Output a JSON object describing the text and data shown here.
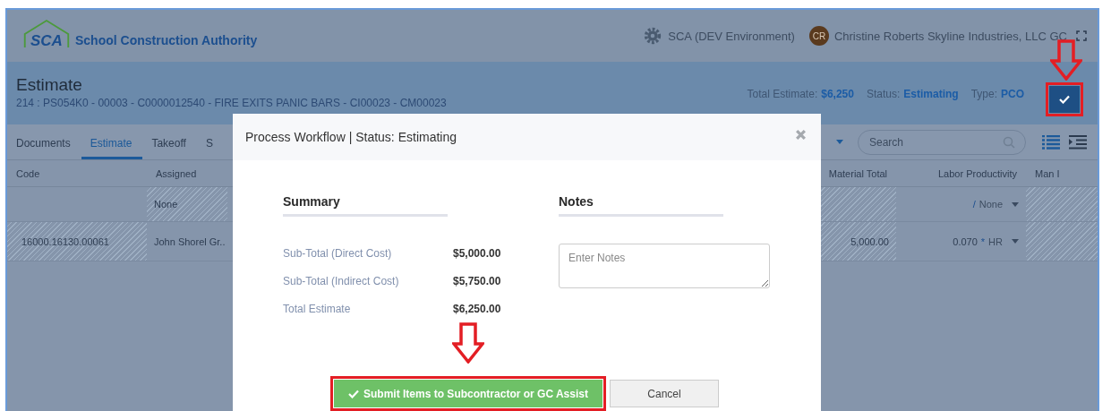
{
  "app": {
    "logo_text": "SCA",
    "name": "School Construction Authority",
    "environment": "SCA (DEV Environment)",
    "user_initials": "CR",
    "user_name": "Christine Roberts Skyline Industries, LLC GC"
  },
  "page": {
    "title": "Estimate",
    "subtitle": "214 : PS054K0 - 00003 - C0000012540 - FIRE EXITS PANIC BARS - CI00023 - CM00023",
    "summary": [
      {
        "label": "Total Estimate:",
        "value": "$6,250"
      },
      {
        "label": "Status:",
        "value": "Estimating"
      },
      {
        "label": "Type:",
        "value": "PCO"
      }
    ],
    "workflow_button": {
      "highlighted": true
    }
  },
  "tabs": [
    {
      "label": "Documents",
      "selected": false
    },
    {
      "label": "Estimate",
      "selected": true
    },
    {
      "label": "Takeoff",
      "selected": false
    },
    {
      "label": "S",
      "selected": false
    }
  ],
  "search": {
    "placeholder": "Search"
  },
  "table": {
    "columns_left": [
      "Code",
      "Assigned"
    ],
    "columns_right": [
      "Material Total",
      "Labor Productivity",
      "Man I"
    ],
    "rows": [
      {
        "code": {
          "hatched": false
        },
        "assigned": {
          "text": "None",
          "hatched": true
        },
        "material": {
          "hatched": true
        },
        "labor": {
          "op": "/",
          "unit": "None"
        },
        "man": {
          "hatched": true
        }
      },
      {
        "code": {
          "text": "16000.16130.00061",
          "hatched": true
        },
        "assigned": {
          "text": "John Shorel Gr..",
          "hatched": false
        },
        "material": {
          "text": "5,000.00",
          "hatched": true
        },
        "labor": {
          "value": "0.070",
          "op": "*",
          "unit": "HR"
        },
        "man": {
          "hatched": true
        }
      }
    ]
  },
  "modal": {
    "title": "Process Workflow | Status: Estimating",
    "summary_heading": "Summary",
    "summary": [
      {
        "label": "Sub-Total (Direct Cost)",
        "value": "$5,000.00"
      },
      {
        "label": "Sub-Total (Indirect Cost)",
        "value": "$5,750.00"
      },
      {
        "label": "Total Estimate",
        "value": "$6,250.00"
      }
    ],
    "notes_heading": "Notes",
    "notes_placeholder": "Enter Notes",
    "buttons": [
      {
        "label": "Submit Items to Subcontractor or GC Assist",
        "kind": "primary",
        "highlighted": true
      },
      {
        "label": "Cancel",
        "kind": "secondary",
        "highlighted": false
      }
    ]
  }
}
